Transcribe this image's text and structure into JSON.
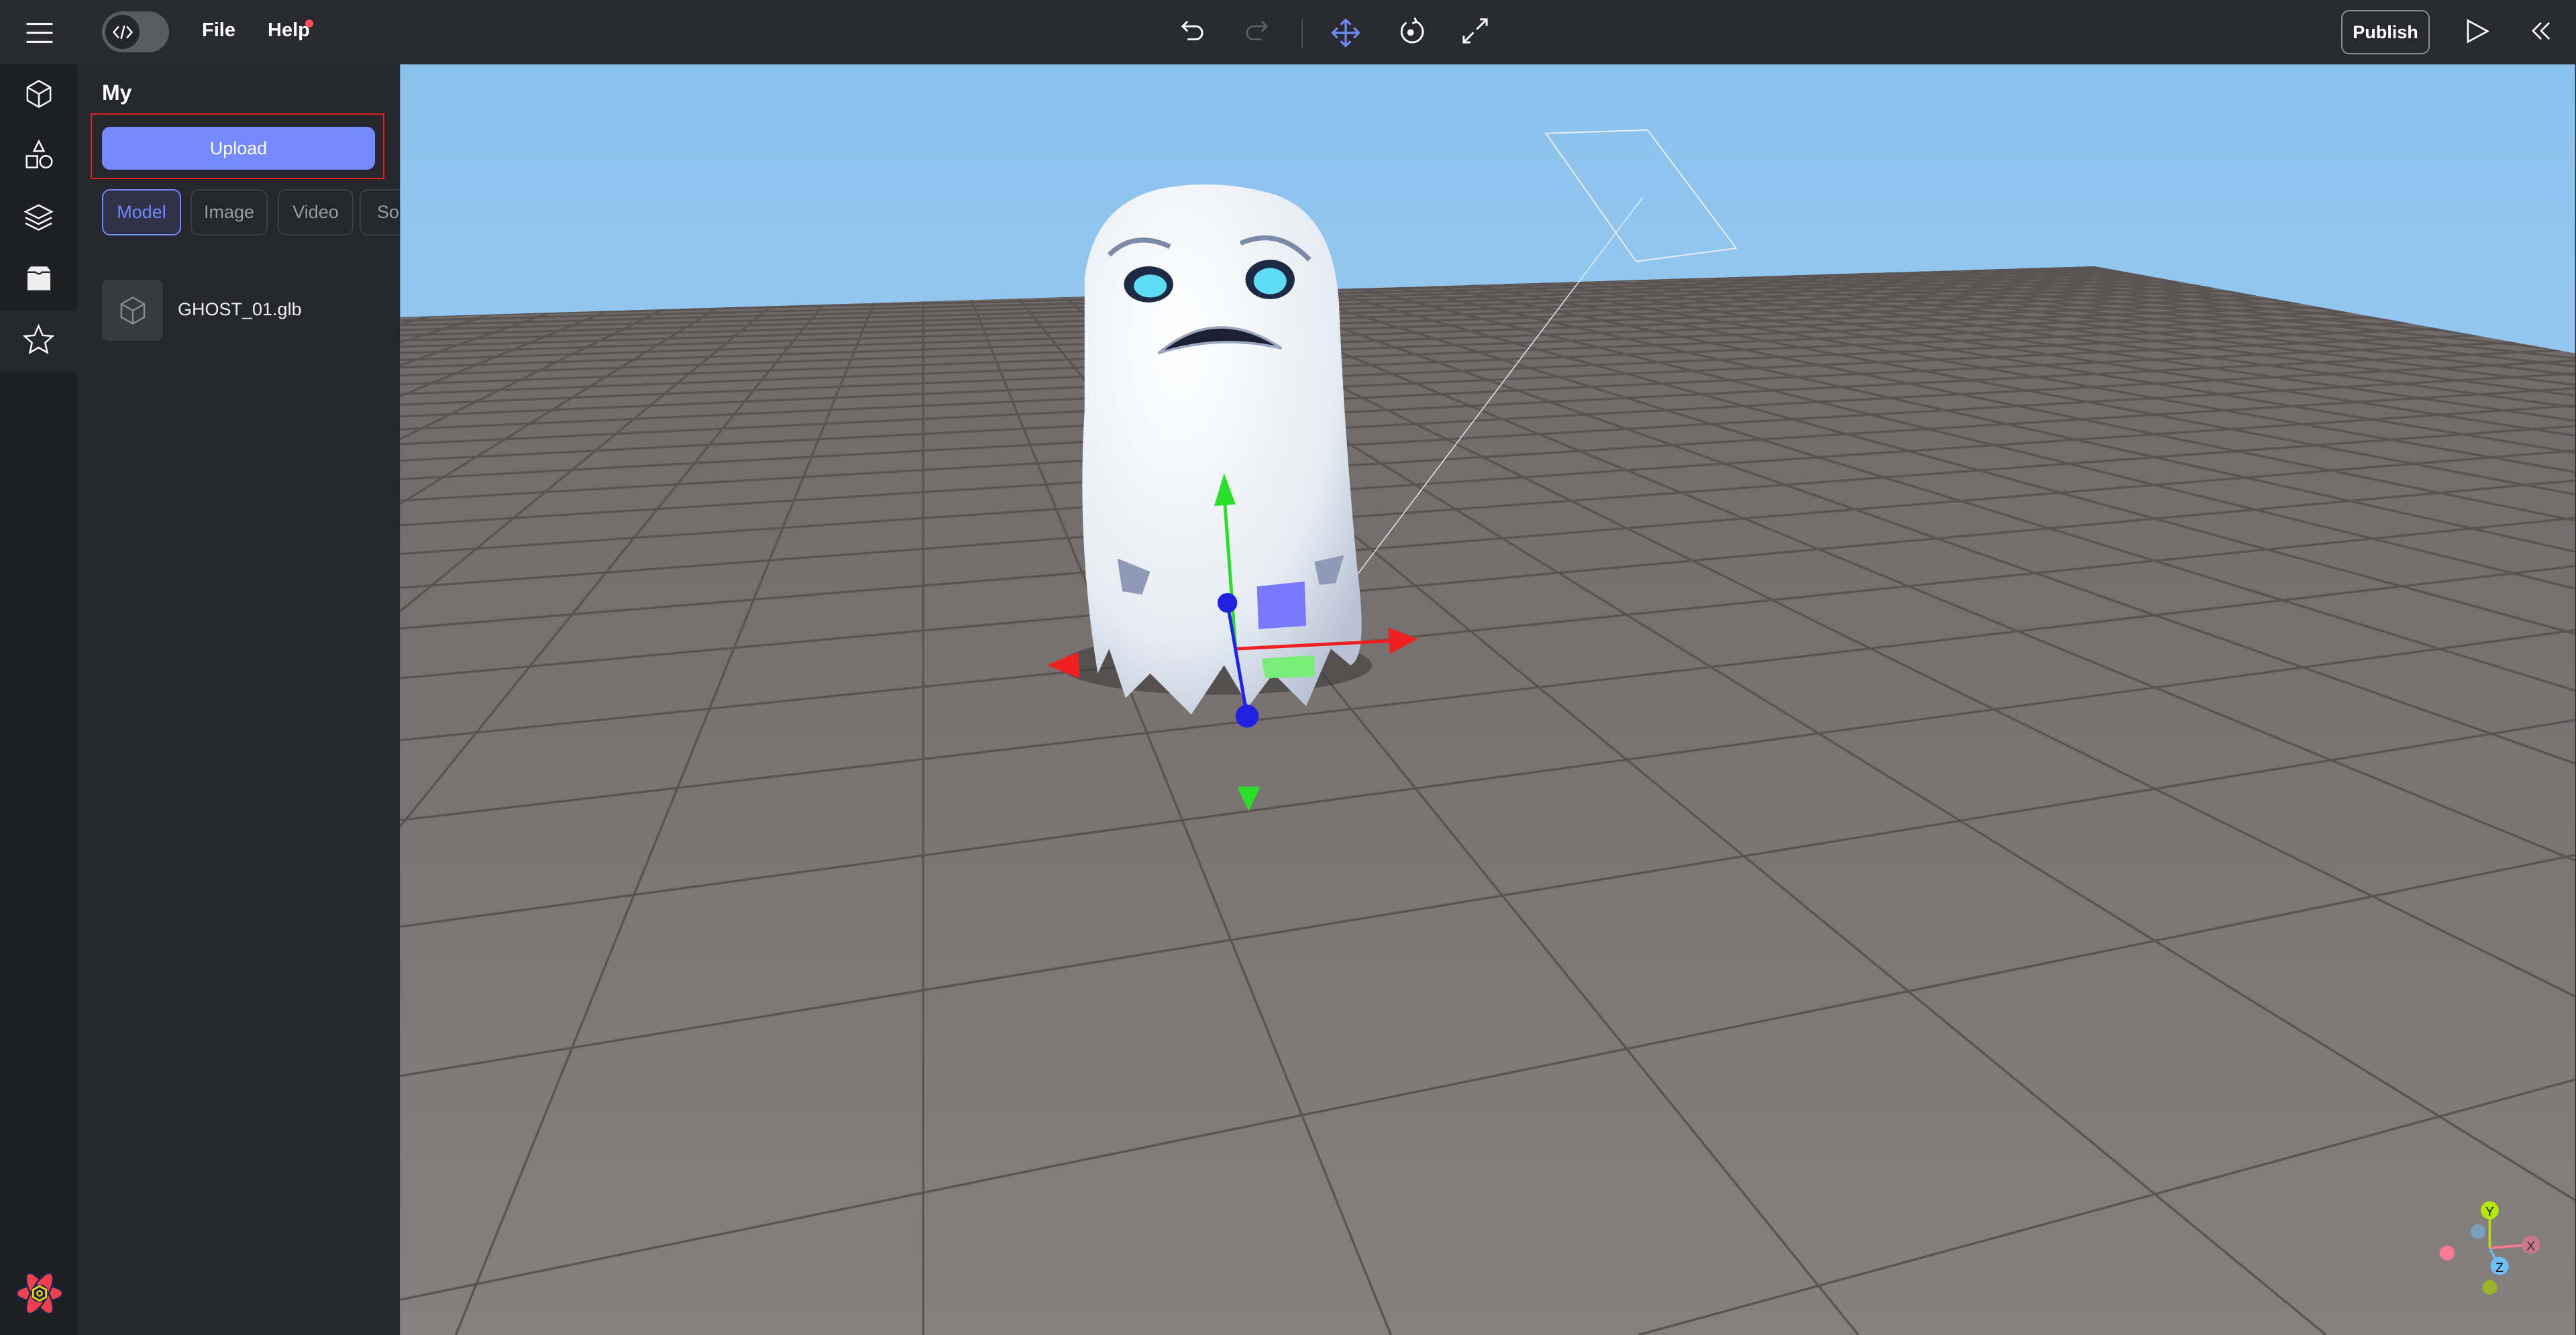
{
  "topbar": {
    "menu_icon": "hamburger-icon",
    "code_toggle_icon": "code-icon",
    "file_label": "File",
    "help_label": "Help",
    "help_badge_color": "#ff4d5e",
    "tools": [
      "undo-icon",
      "redo-icon",
      "move-icon",
      "rotate-icon",
      "scale-icon"
    ],
    "active_tool": "move",
    "publish_label": "Publish",
    "play_icon": "play-icon",
    "collapse_icon": "double-chevron-left-icon"
  },
  "rail": {
    "items": [
      "cube-icon",
      "shapes-icon",
      "layers-icon",
      "inbox-icon",
      "star-icon"
    ],
    "active": "inbox-icon"
  },
  "panel": {
    "title": "My",
    "upload_label": "Upload",
    "accent": "#7589ff",
    "tabs": [
      {
        "label": "Model",
        "active": true
      },
      {
        "label": "Image",
        "active": false
      },
      {
        "label": "Video",
        "active": false
      },
      {
        "label": "Sound",
        "active": false
      }
    ],
    "files": [
      {
        "name": "GHOST_01.glb",
        "icon": "cube-icon"
      }
    ]
  },
  "viewport": {
    "axis_labels": {
      "x": "X",
      "y": "Y",
      "z": "Z"
    }
  }
}
